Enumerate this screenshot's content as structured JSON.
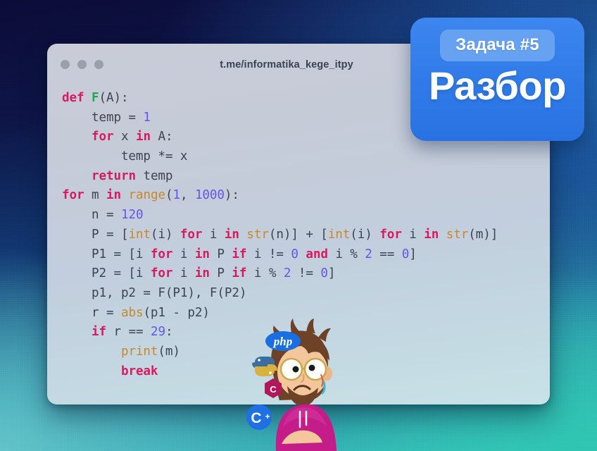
{
  "window": {
    "title": "t.me/informatika_kege_itpy",
    "traffic_lights": [
      "close",
      "minimize",
      "maximize"
    ]
  },
  "badge": {
    "task_label": "Задача #5",
    "headline": "Разбор",
    "card_color": "#2f7ae8",
    "pill_color": "#66a1f2",
    "text_color": "#ffffff"
  },
  "colors": {
    "keyword": "#d81b60",
    "function": "#1faa52",
    "builtin": "#c8882c",
    "number": "#6257e8",
    "plain": "#3f4450",
    "window_bg": "#c6cbd8",
    "background_top": "#0b0b36",
    "background_bottom": "#38c3ba"
  },
  "code": {
    "language": "python",
    "lines": [
      [
        {
          "t": "def",
          "c": "kw"
        },
        {
          "t": " ",
          "c": "pl"
        },
        {
          "t": "F",
          "c": "fn"
        },
        {
          "t": "(A):",
          "c": "pl"
        }
      ],
      [
        {
          "t": "    temp = ",
          "c": "pl"
        },
        {
          "t": "1",
          "c": "num"
        }
      ],
      [
        {
          "t": "    ",
          "c": "pl"
        },
        {
          "t": "for",
          "c": "kw"
        },
        {
          "t": " x ",
          "c": "pl"
        },
        {
          "t": "in",
          "c": "kw"
        },
        {
          "t": " A:",
          "c": "pl"
        }
      ],
      [
        {
          "t": "        temp *= x",
          "c": "pl"
        }
      ],
      [
        {
          "t": "    ",
          "c": "pl"
        },
        {
          "t": "return",
          "c": "kw"
        },
        {
          "t": " temp",
          "c": "pl"
        }
      ],
      [
        {
          "t": "for",
          "c": "kw"
        },
        {
          "t": " m ",
          "c": "pl"
        },
        {
          "t": "in",
          "c": "kw"
        },
        {
          "t": " ",
          "c": "pl"
        },
        {
          "t": "range",
          "c": "bi"
        },
        {
          "t": "(",
          "c": "pl"
        },
        {
          "t": "1",
          "c": "num"
        },
        {
          "t": ", ",
          "c": "pl"
        },
        {
          "t": "1000",
          "c": "num"
        },
        {
          "t": "):",
          "c": "pl"
        }
      ],
      [
        {
          "t": "    n = ",
          "c": "pl"
        },
        {
          "t": "120",
          "c": "num"
        }
      ],
      [
        {
          "t": "    P = [",
          "c": "pl"
        },
        {
          "t": "int",
          "c": "bi"
        },
        {
          "t": "(i) ",
          "c": "pl"
        },
        {
          "t": "for",
          "c": "kw"
        },
        {
          "t": " i ",
          "c": "pl"
        },
        {
          "t": "in",
          "c": "kw"
        },
        {
          "t": " ",
          "c": "pl"
        },
        {
          "t": "str",
          "c": "bi"
        },
        {
          "t": "(n)] + [",
          "c": "pl"
        },
        {
          "t": "int",
          "c": "bi"
        },
        {
          "t": "(i) ",
          "c": "pl"
        },
        {
          "t": "for",
          "c": "kw"
        },
        {
          "t": " i ",
          "c": "pl"
        },
        {
          "t": "in",
          "c": "kw"
        },
        {
          "t": " ",
          "c": "pl"
        },
        {
          "t": "str",
          "c": "bi"
        },
        {
          "t": "(m)]",
          "c": "pl"
        }
      ],
      [
        {
          "t": "    P1 = [i ",
          "c": "pl"
        },
        {
          "t": "for",
          "c": "kw"
        },
        {
          "t": " i ",
          "c": "pl"
        },
        {
          "t": "in",
          "c": "kw"
        },
        {
          "t": " P ",
          "c": "pl"
        },
        {
          "t": "if",
          "c": "kw"
        },
        {
          "t": " i != ",
          "c": "pl"
        },
        {
          "t": "0",
          "c": "num"
        },
        {
          "t": " ",
          "c": "pl"
        },
        {
          "t": "and",
          "c": "kw"
        },
        {
          "t": " i % ",
          "c": "pl"
        },
        {
          "t": "2",
          "c": "num"
        },
        {
          "t": " == ",
          "c": "pl"
        },
        {
          "t": "0",
          "c": "num"
        },
        {
          "t": "]",
          "c": "pl"
        }
      ],
      [
        {
          "t": "    P2 = [i ",
          "c": "pl"
        },
        {
          "t": "for",
          "c": "kw"
        },
        {
          "t": " i ",
          "c": "pl"
        },
        {
          "t": "in",
          "c": "kw"
        },
        {
          "t": " P ",
          "c": "pl"
        },
        {
          "t": "if",
          "c": "kw"
        },
        {
          "t": " i % ",
          "c": "pl"
        },
        {
          "t": "2",
          "c": "num"
        },
        {
          "t": " != ",
          "c": "pl"
        },
        {
          "t": "0",
          "c": "num"
        },
        {
          "t": "]",
          "c": "pl"
        }
      ],
      [
        {
          "t": "    p1, p2 = F(P1), F(P2)",
          "c": "pl"
        }
      ],
      [
        {
          "t": "    r = ",
          "c": "pl"
        },
        {
          "t": "abs",
          "c": "bi"
        },
        {
          "t": "(p1 - p2)",
          "c": "pl"
        }
      ],
      [
        {
          "t": "    ",
          "c": "pl"
        },
        {
          "t": "if",
          "c": "kw"
        },
        {
          "t": " r == ",
          "c": "pl"
        },
        {
          "t": "29",
          "c": "num"
        },
        {
          "t": ":",
          "c": "pl"
        }
      ],
      [
        {
          "t": "        ",
          "c": "pl"
        },
        {
          "t": "print",
          "c": "bi"
        },
        {
          "t": "(m)",
          "c": "pl"
        }
      ],
      [
        {
          "t": "        ",
          "c": "pl"
        },
        {
          "t": "break",
          "c": "kw"
        }
      ]
    ]
  },
  "mascot": {
    "description": "confused-programmer-character",
    "logos": [
      "php",
      "python",
      "c-sharp",
      "c-plus-plus"
    ]
  }
}
